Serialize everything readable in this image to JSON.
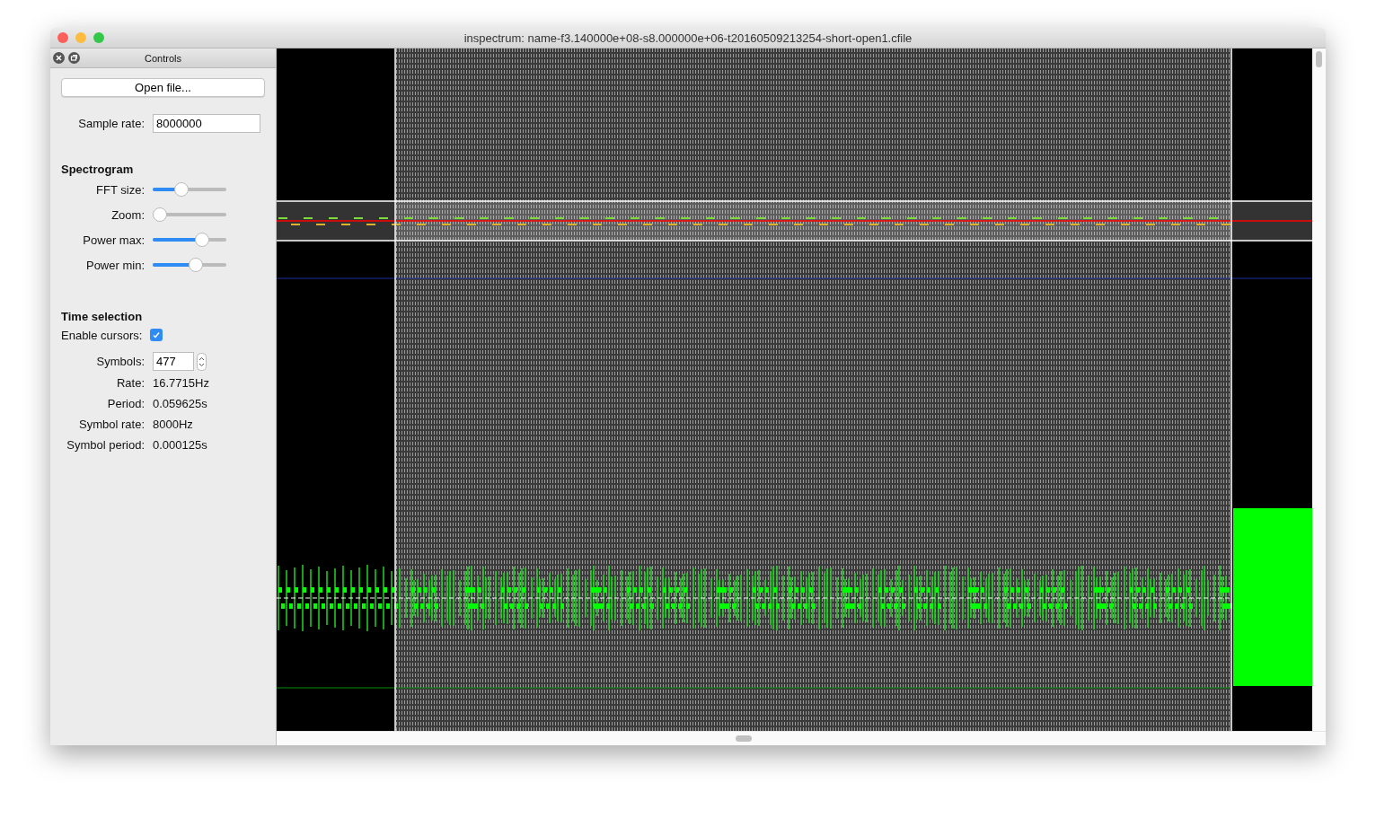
{
  "window": {
    "title": "inspectrum: name-f3.140000e+08-s8.000000e+06-t20160509213254-short-open1.cfile"
  },
  "panel": {
    "title": "Controls",
    "open_button": "Open file...",
    "sample_rate": {
      "label": "Sample rate:",
      "value": "8000000"
    },
    "spectrogram": {
      "heading": "Spectrogram",
      "sliders": [
        {
          "label": "FFT size:",
          "level": 0.36
        },
        {
          "label": "Zoom:",
          "level": 0.0
        },
        {
          "label": "Power max:",
          "level": 0.71
        },
        {
          "label": "Power min:",
          "level": 0.61
        }
      ]
    },
    "time_selection": {
      "heading": "Time selection",
      "enable_cursors": {
        "label": "Enable cursors:",
        "checked": true
      },
      "symbols": {
        "label": "Symbols:",
        "value": "477"
      },
      "readouts": [
        {
          "label": "Rate:",
          "value": "16.7715Hz"
        },
        {
          "label": "Period:",
          "value": "0.059625s"
        },
        {
          "label": "Symbol rate:",
          "value": "8000Hz"
        },
        {
          "label": "Symbol period:",
          "value": "0.000125s"
        }
      ]
    }
  }
}
